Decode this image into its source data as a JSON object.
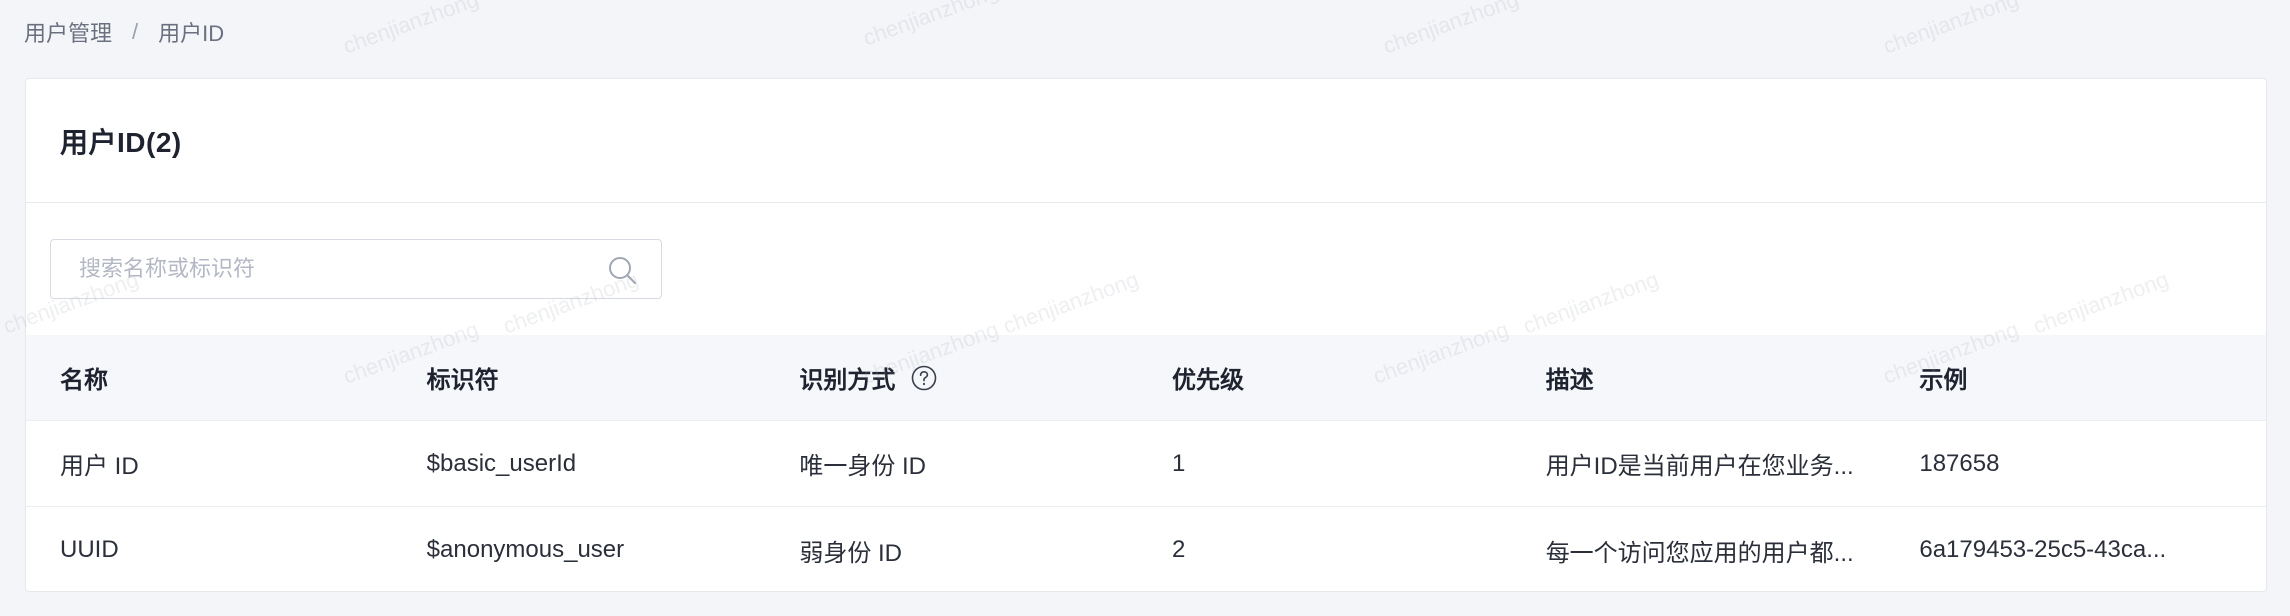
{
  "breadcrumb": {
    "parent": "用户管理",
    "separator": "/",
    "current": "用户ID"
  },
  "card": {
    "title": "用户ID(2)"
  },
  "search": {
    "placeholder": "搜索名称或标识符",
    "value": ""
  },
  "table": {
    "columns": {
      "name": "名称",
      "identifier": "标识符",
      "method": "识别方式",
      "priority": "优先级",
      "description": "描述",
      "example": "示例"
    },
    "rows": [
      {
        "name": "用户 ID",
        "identifier": "$basic_userId",
        "method": "唯一身份 ID",
        "priority": "1",
        "description": "用户ID是当前用户在您业务...",
        "example": "187658"
      },
      {
        "name": "UUID",
        "identifier": "$anonymous_user",
        "method": "弱身份 ID",
        "priority": "2",
        "description": "每一个访问您应用的用户都...",
        "example": "6a179453-25c5-43ca..."
      }
    ]
  },
  "watermark": {
    "text": "chenjianzhong"
  },
  "colors": {
    "background": "#f4f5f8",
    "card": "#ffffff",
    "header_row": "#f6f7fa",
    "text": "#2b2f3a",
    "muted": "#6b7080"
  },
  "icons": {
    "search": "search-icon",
    "help": "help-circle-icon"
  }
}
